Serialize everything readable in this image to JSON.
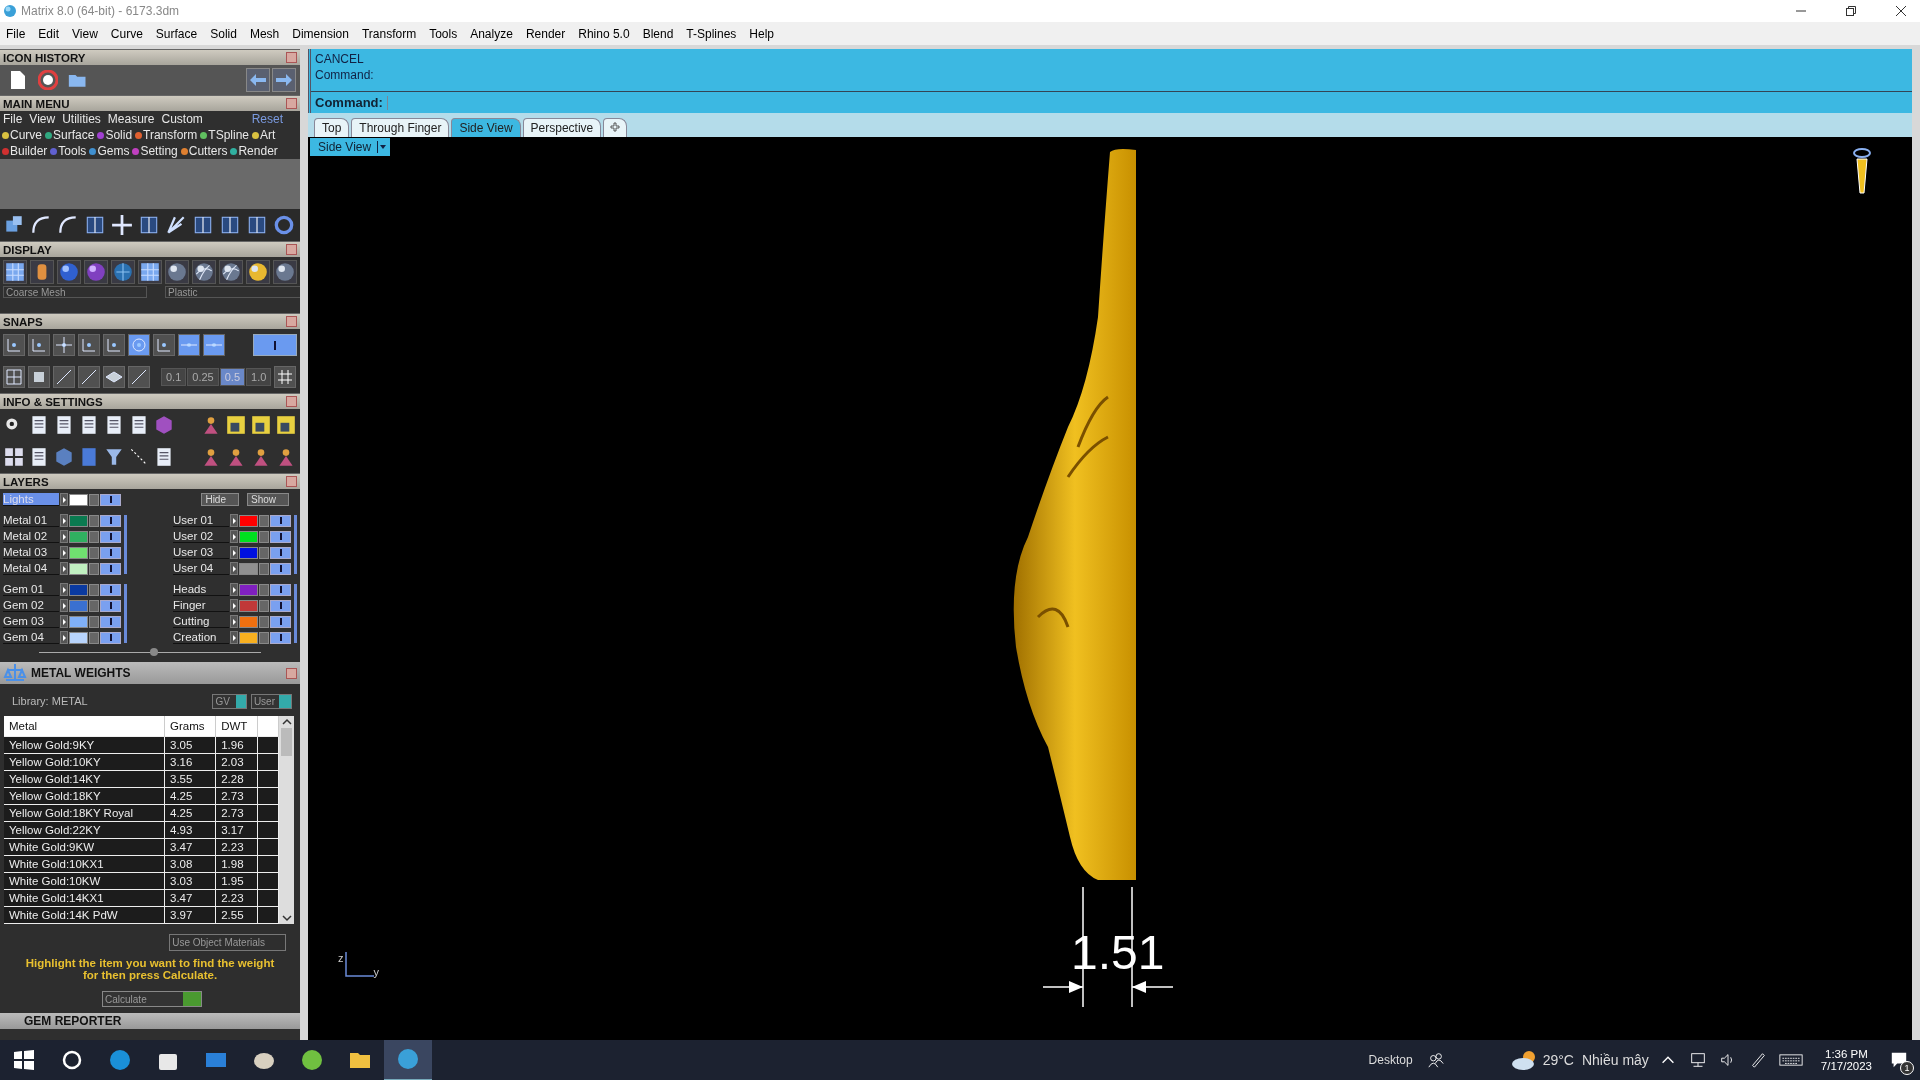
{
  "window": {
    "title": "Matrix 8.0 (64-bit) - 6173.3dm"
  },
  "menu_bar": [
    "File",
    "Edit",
    "View",
    "Curve",
    "Surface",
    "Solid",
    "Mesh",
    "Dimension",
    "Transform",
    "Tools",
    "Analyze",
    "Render",
    "Rhino 5.0",
    "Blend",
    "T-Splines",
    "Help"
  ],
  "icon_history": {
    "title": "ICON HISTORY"
  },
  "main_menu": {
    "title": "MAIN MENU",
    "menu": [
      "File",
      "View",
      "Utilities",
      "Measure",
      "Custom"
    ],
    "reset": "Reset",
    "category_rows": [
      [
        {
          "label": "Curve",
          "color": "#d8c040"
        },
        {
          "label": "Surface",
          "color": "#30a880"
        },
        {
          "label": "Solid",
          "color": "#a040d0"
        },
        {
          "label": "Transform",
          "color": "#e06030"
        },
        {
          "label": "TSpline",
          "color": "#60c060"
        },
        {
          "label": "Art",
          "color": "#d8c040"
        }
      ],
      [
        {
          "label": "Builder",
          "color": "#d03030"
        },
        {
          "label": "Tools",
          "color": "#6060d0"
        },
        {
          "label": "Gems",
          "color": "#4090d0"
        },
        {
          "label": "Setting",
          "color": "#c040c0"
        },
        {
          "label": "Cutters",
          "color": "#e08030"
        },
        {
          "label": "Render",
          "color": "#30b0a0"
        }
      ]
    ]
  },
  "display": {
    "title": "DISPLAY",
    "mesh": "Coarse Mesh",
    "material": "Plastic"
  },
  "snaps": {
    "title": "SNAPS",
    "steps": [
      {
        "label": "0.1",
        "selected": false
      },
      {
        "label": "0.25",
        "selected": false
      },
      {
        "label": "0.5",
        "selected": true
      },
      {
        "label": "1.0",
        "selected": false
      }
    ]
  },
  "info_settings": {
    "title": "INFO & SETTINGS"
  },
  "layers": {
    "title": "LAYERS",
    "lights": {
      "name": "Lights",
      "color": "#ffffff",
      "visible": true
    },
    "hide": "Hide",
    "show": "Show",
    "groups": [
      {
        "left": [
          {
            "name": "Metal 01",
            "color": "#0a7a50",
            "visible": true
          },
          {
            "name": "Metal 02",
            "color": "#30b060",
            "visible": true
          },
          {
            "name": "Metal 03",
            "color": "#70e070",
            "visible": true
          },
          {
            "name": "Metal 04",
            "color": "#c0f0c0",
            "visible": true
          }
        ],
        "right": [
          {
            "name": "User 01",
            "color": "#ff0000",
            "visible": true
          },
          {
            "name": "User 02",
            "color": "#00e020",
            "visible": true
          },
          {
            "name": "User 03",
            "color": "#0010e0",
            "visible": true
          },
          {
            "name": "User 04",
            "color": "#909090",
            "visible": true
          }
        ]
      },
      {
        "left": [
          {
            "name": "Gem 01",
            "color": "#0a3aa0",
            "visible": true
          },
          {
            "name": "Gem 02",
            "color": "#3a70d0",
            "visible": true
          },
          {
            "name": "Gem 03",
            "color": "#80b0f8",
            "visible": true
          },
          {
            "name": "Gem 04",
            "color": "#b8d4fc",
            "visible": true
          }
        ],
        "right": [
          {
            "name": "Heads",
            "color": "#8020c0",
            "visible": true
          },
          {
            "name": "Finger",
            "color": "#c03838",
            "visible": true
          },
          {
            "name": "Cutting",
            "color": "#f07010",
            "visible": true
          },
          {
            "name": "Creation",
            "color": "#f8b020",
            "visible": true
          }
        ]
      }
    ]
  },
  "metal_weights": {
    "title": "METAL WEIGHTS",
    "library": "Library: METAL",
    "gv": "GV",
    "user": "User",
    "columns": [
      "Metal",
      "Grams",
      "DWT"
    ],
    "rows": [
      [
        "Yellow Gold:9KY",
        "3.05",
        "1.96"
      ],
      [
        "Yellow Gold:10KY",
        "3.16",
        "2.03"
      ],
      [
        "Yellow Gold:14KY",
        "3.55",
        "2.28"
      ],
      [
        "Yellow Gold:18KY",
        "4.25",
        "2.73"
      ],
      [
        "Yellow Gold:18KY Royal",
        "4.25",
        "2.73"
      ],
      [
        "Yellow Gold:22KY",
        "4.93",
        "3.17"
      ],
      [
        "White Gold:9KW",
        "3.47",
        "2.23"
      ],
      [
        "White Gold:10KX1",
        "3.08",
        "1.98"
      ],
      [
        "White Gold:10KW",
        "3.03",
        "1.95"
      ],
      [
        "White Gold:14KX1",
        "3.47",
        "2.23"
      ],
      [
        "White Gold:14K PdW",
        "3.97",
        "2.55"
      ]
    ],
    "use_object_materials": "Use Object Materials",
    "hint": "Highlight the item you want to find the weight for then press Calculate.",
    "calculate": "Calculate"
  },
  "gem_reporter": {
    "title": "GEM REPORTER"
  },
  "command": {
    "history": [
      "CANCEL",
      "Command:"
    ],
    "prompt": "Command:"
  },
  "viewport_tabs": [
    {
      "label": "Top",
      "selected": false
    },
    {
      "label": "Through Finger",
      "selected": false
    },
    {
      "label": "Side View",
      "selected": true
    },
    {
      "label": "Perspective",
      "selected": false
    }
  ],
  "viewport": {
    "label": "Side View",
    "dimension": "1.51",
    "axis_up": "z",
    "axis_right": "y"
  },
  "taskbar": {
    "desktop": "Desktop",
    "temperature": "29°C",
    "weather": "Nhiều mây",
    "time": "1:36 PM",
    "date": "7/17/2023",
    "notifications": "1"
  }
}
